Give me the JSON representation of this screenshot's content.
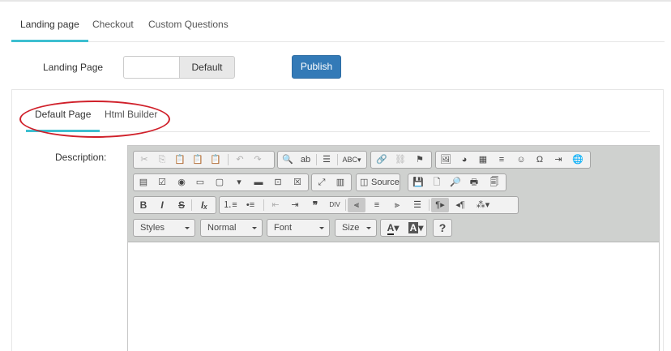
{
  "main_tabs": [
    {
      "label": "Landing page",
      "active": true
    },
    {
      "label": "Checkout",
      "active": false
    },
    {
      "label": "Custom Questions",
      "active": false
    }
  ],
  "landing": {
    "label": "Landing Page",
    "input_value": "",
    "default_label": "Default",
    "publish_label": "Publish"
  },
  "sub_tabs": [
    {
      "label": "Default Page",
      "active": true
    },
    {
      "label": "Html Builder",
      "active": false
    }
  ],
  "description_label": "Description:",
  "editor": {
    "source_label": "Source",
    "styles_combo": "Styles",
    "format_combo": "Normal",
    "font_combo": "Font",
    "size_combo": "Size",
    "help_label": "?"
  },
  "colors": {
    "accent_tab": "#3dbfd0",
    "publish_bg": "#337ab7",
    "annotation": "#d0202a",
    "toolbar_bg": "#cfd1cf"
  }
}
